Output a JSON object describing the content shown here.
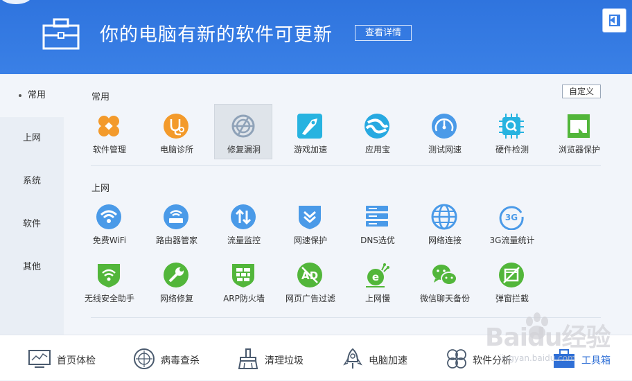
{
  "header": {
    "title": "你的电脑有新的软件可更新",
    "detail_button": "查看详情"
  },
  "sidebar": {
    "items": [
      "常用",
      "上网",
      "系统",
      "软件",
      "其他"
    ]
  },
  "sections": {
    "common": "常用",
    "internet": "上网",
    "customize_button": "自定义"
  },
  "tools_common": [
    {
      "label": "软件管理",
      "icon": "software-manager-icon"
    },
    {
      "label": "电脑诊所",
      "icon": "stethoscope-icon"
    },
    {
      "label": "修复漏洞",
      "icon": "fix-vulnerability-icon"
    },
    {
      "label": "游戏加速",
      "icon": "game-boost-icon"
    },
    {
      "label": "应用宝",
      "icon": "app-store-icon"
    },
    {
      "label": "测试网速",
      "icon": "speed-test-icon"
    },
    {
      "label": "硬件检测",
      "icon": "hardware-check-icon"
    },
    {
      "label": "浏览器保护",
      "icon": "browser-protect-icon"
    }
  ],
  "tools_internet_row1": [
    {
      "label": "免费WiFi",
      "icon": "wifi-icon"
    },
    {
      "label": "路由器管家",
      "icon": "router-icon"
    },
    {
      "label": "流量监控",
      "icon": "traffic-monitor-icon"
    },
    {
      "label": "网速保护",
      "icon": "speed-protect-icon"
    },
    {
      "label": "DNS选优",
      "icon": "dns-icon"
    },
    {
      "label": "网络连接",
      "icon": "globe-icon"
    },
    {
      "label": "3G流量统计",
      "icon": "3g-icon"
    }
  ],
  "tools_internet_row2": [
    {
      "label": "无线安全助手",
      "icon": "wireless-security-icon"
    },
    {
      "label": "网络修复",
      "icon": "wrench-icon"
    },
    {
      "label": "ARP防火墙",
      "icon": "firewall-icon"
    },
    {
      "label": "网页广告过滤",
      "icon": "ad-filter-icon"
    },
    {
      "label": "上网慢",
      "icon": "slow-internet-icon"
    },
    {
      "label": "微信聊天备份",
      "icon": "wechat-backup-icon"
    },
    {
      "label": "弹窗拦截",
      "icon": "popup-block-icon"
    }
  ],
  "footer": [
    {
      "label": "首页体检",
      "icon": "monitor-icon"
    },
    {
      "label": "病毒查杀",
      "icon": "virus-scan-icon"
    },
    {
      "label": "清理垃圾",
      "icon": "broom-icon"
    },
    {
      "label": "电脑加速",
      "icon": "rocket-icon"
    },
    {
      "label": "软件分析",
      "icon": "software-analysis-icon"
    },
    {
      "label": "工具箱",
      "icon": "toolbox-icon"
    }
  ],
  "colors": {
    "header_blue": "#3a80e6",
    "icon_blue": "#4a9ae8",
    "icon_green": "#52b63a",
    "icon_orange": "#f39a2b"
  },
  "watermark": {
    "text": "Baidu经验",
    "url": "jingyan.baidu.com"
  }
}
